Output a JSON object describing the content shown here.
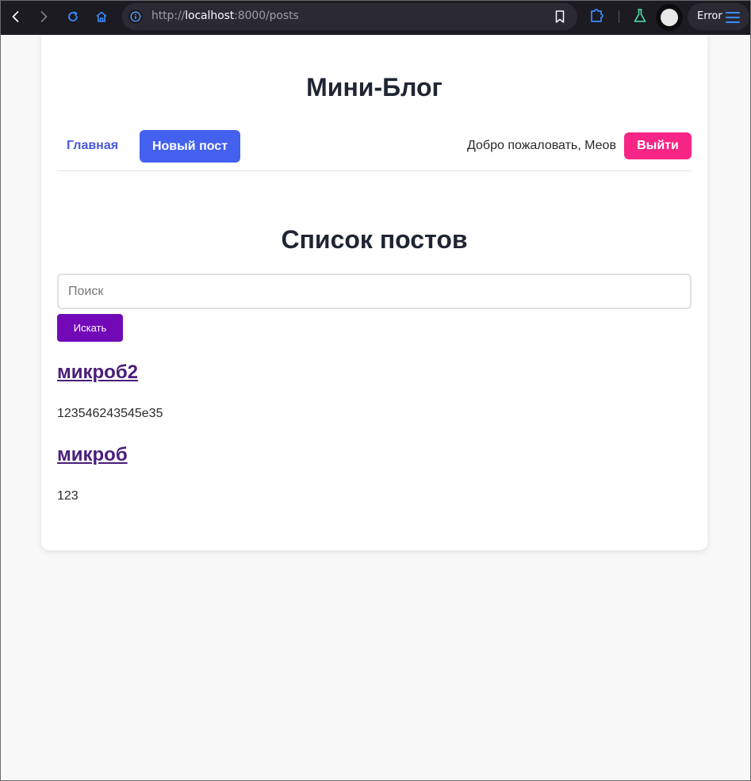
{
  "browser": {
    "url_scheme": "http://",
    "url_host": "localhost",
    "url_rest": ":8000/posts",
    "error_label": "Error",
    "icons": [
      "back-icon",
      "forward-icon",
      "reload-icon",
      "home-icon",
      "info-icon",
      "bookmark-icon",
      "extensions-icon",
      "flask-icon",
      "avatar-icon",
      "menu-icon"
    ]
  },
  "header": {
    "site_title": "Мини-Блог"
  },
  "nav": {
    "home_label": "Главная",
    "new_post_label": "Новый пост",
    "welcome_text": "Добро пожаловать, Меов",
    "logout_label": "Выйти"
  },
  "main": {
    "title": "Список постов",
    "search_placeholder": "Поиск",
    "search_value": "",
    "search_button_label": "Искать",
    "posts": [
      {
        "title": "микроб2",
        "body": "123546243545e35"
      },
      {
        "title": "микроб",
        "body": "123"
      }
    ]
  },
  "colors": {
    "primary": "#4361ee",
    "danger": "#f72585",
    "accent": "#7209b7",
    "link": "#4a1d7a"
  }
}
